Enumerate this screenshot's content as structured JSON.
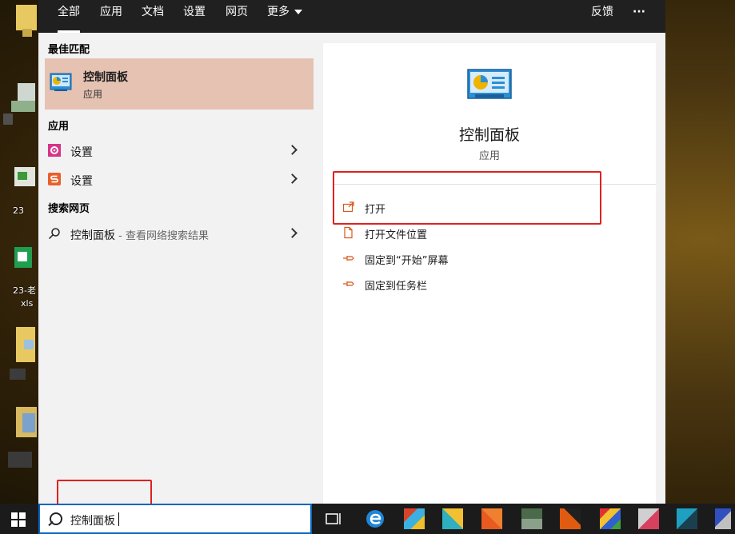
{
  "tabs": [
    {
      "label": "全部",
      "active": true
    },
    {
      "label": "应用"
    },
    {
      "label": "文档"
    },
    {
      "label": "设置"
    },
    {
      "label": "网页"
    },
    {
      "label": "更多"
    }
  ],
  "top_right": {
    "feedback": "反馈",
    "more": "···"
  },
  "sections": {
    "best_match": "最佳匹配",
    "apps": "应用",
    "web_search": "搜索网页"
  },
  "best_match": {
    "title": "控制面板",
    "subtitle": "应用"
  },
  "apps": [
    {
      "label": "设置",
      "icon": "gear-icon"
    },
    {
      "label": "设置",
      "icon": "s-logo-icon"
    }
  ],
  "web": {
    "label": "控制面板",
    "suffix": " - 查看网络搜索结果"
  },
  "preview": {
    "title": "控制面板",
    "subtitle": "应用"
  },
  "actions": [
    {
      "label": "打开",
      "icon": "open-icon"
    },
    {
      "label": "打开文件位置",
      "icon": "file-location-icon"
    },
    {
      "label": "固定到“开始”屏幕",
      "icon": "pin-icon"
    },
    {
      "label": "固定到任务栏",
      "icon": "pin-icon"
    }
  ],
  "search": {
    "value": "控制面板"
  },
  "desktop_labels": [
    "23-老",
    "xls",
    "23"
  ],
  "colors": {
    "highlight": "#e5c2b2",
    "accent_orange": "#d8581a",
    "red_box": "#e02020",
    "topbar": "#202020"
  }
}
